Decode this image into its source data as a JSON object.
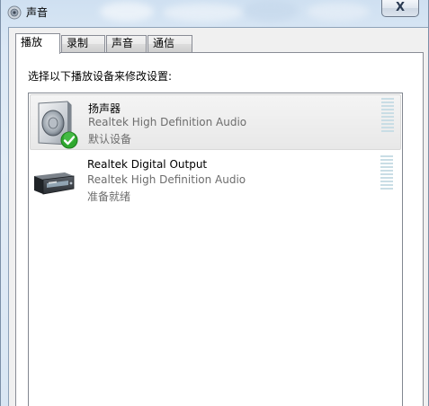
{
  "window": {
    "title": "声音",
    "close_label": "X"
  },
  "tabs": [
    {
      "label": "播放",
      "active": true
    },
    {
      "label": "录制",
      "active": false
    },
    {
      "label": "声音",
      "active": false
    },
    {
      "label": "通信",
      "active": false
    }
  ],
  "playback": {
    "instruction": "选择以下播放设备来修改设置:",
    "devices": [
      {
        "name": "扬声器",
        "description": "Realtek High Definition Audio",
        "status": "默认设备",
        "icon": "speaker-icon",
        "badge": "default-check-icon",
        "selected": true
      },
      {
        "name": "Realtek Digital Output",
        "description": "Realtek High Definition Audio",
        "status": "准备就绪",
        "icon": "digital-output-icon",
        "selected": false
      }
    ]
  },
  "colors": {
    "meter_bar": "#c9dde5",
    "check_green": "#2fa82f",
    "selection": "#e8e8e8"
  }
}
